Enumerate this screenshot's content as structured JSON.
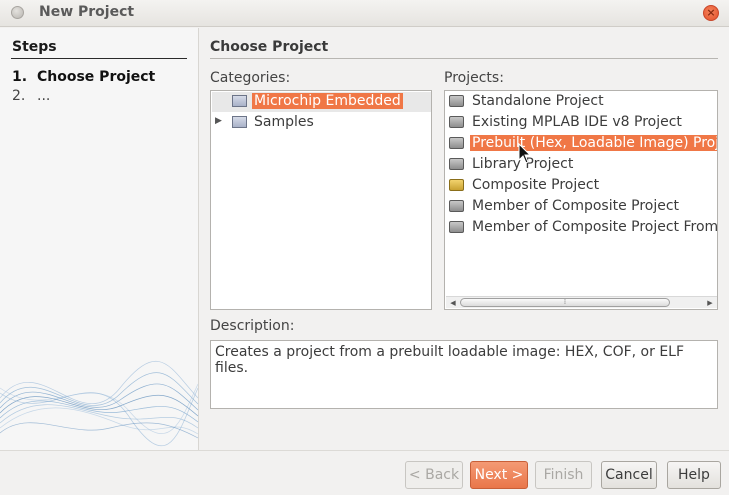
{
  "window": {
    "title": "New Project"
  },
  "steps": {
    "title": "Steps",
    "items": [
      {
        "num": "1.",
        "label": "Choose Project"
      },
      {
        "num": "2.",
        "label": "..."
      }
    ]
  },
  "main": {
    "title": "Choose Project",
    "categories_label": "Categories:",
    "projects_label": "Projects:",
    "description_label": "Description:",
    "categories": [
      {
        "label": "Microchip Embedded",
        "icon": "folder-icon",
        "selected": true
      },
      {
        "label": "Samples",
        "icon": "folder-icon",
        "selected": false
      }
    ],
    "projects": [
      {
        "label": "Standalone Project",
        "icon": "project-icon"
      },
      {
        "label": "Existing MPLAB IDE v8 Project",
        "icon": "project-icon"
      },
      {
        "label": "Prebuilt (Hex, Loadable Image) Proje",
        "icon": "project-icon",
        "selected": true
      },
      {
        "label": "Library Project",
        "icon": "project-icon"
      },
      {
        "label": "Composite Project",
        "icon": "composite-project-icon"
      },
      {
        "label": "Member of Composite Project",
        "icon": "project-icon"
      },
      {
        "label": "Member of Composite Project From",
        "icon": "project-icon"
      }
    ],
    "description": "Creates a project from a prebuilt loadable image: HEX, COF, or ELF files."
  },
  "buttons": {
    "back": "< Back",
    "next": "Next >",
    "finish": "Finish",
    "cancel": "Cancel",
    "help": "Help"
  },
  "colors": {
    "selection": "#f07746",
    "primary_button": "#e9764a",
    "close_button": "#e2502a"
  }
}
